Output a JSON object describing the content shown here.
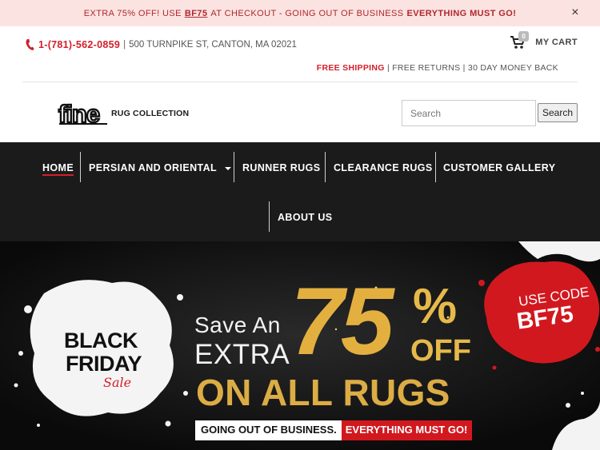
{
  "announcement": {
    "prefix": "EXTRA 75% OFF! USE",
    "code": "BF75",
    "middle": "AT CHECKOUT - GOING OUT OF BUSINESS",
    "emphasis": "EVERYTHING MUST GO!",
    "close_label": "×"
  },
  "contact": {
    "phone": "1-(781)-562-0859",
    "separator": "|",
    "address": "500 TURNPIKE ST, CANTON, MA 02021"
  },
  "cart": {
    "count": "0",
    "label": "MY CART"
  },
  "perks": {
    "free_shipping": "FREE SHIPPING",
    "rest": " | FREE RETURNS | 30 DAY MONEY BACK"
  },
  "logo": {
    "word": "fine",
    "subtitle": "RUG COLLECTION"
  },
  "search": {
    "placeholder": "Search",
    "button_label": "Search"
  },
  "nav": {
    "items": [
      {
        "label": "HOME"
      },
      {
        "label": "PERSIAN AND ORIENTAL"
      },
      {
        "label": "RUNNER RUGS"
      },
      {
        "label": "CLEARANCE RUGS"
      },
      {
        "label": "CUSTOMER GALLERY"
      },
      {
        "label": "ABOUT US"
      }
    ]
  },
  "hero": {
    "badge_line1": "BLACK",
    "badge_line2": "FRIDAY",
    "badge_line3": "Sale",
    "save_an": "Save An",
    "extra": "EXTRA",
    "big_number": "75",
    "percent": "%",
    "off": "OFF",
    "on_all": "ON ALL RUGS",
    "strip_white": "GOING OUT OF BUSINESS.",
    "strip_red": "EVERYTHING MUST GO!",
    "use_code": "USE CODE",
    "code": "BF75"
  },
  "colors": {
    "brand_red": "#d21f2a",
    "nav_bg": "#1c1b1b",
    "announce_bg": "#fbe3e1",
    "gold": "#e3b040"
  }
}
